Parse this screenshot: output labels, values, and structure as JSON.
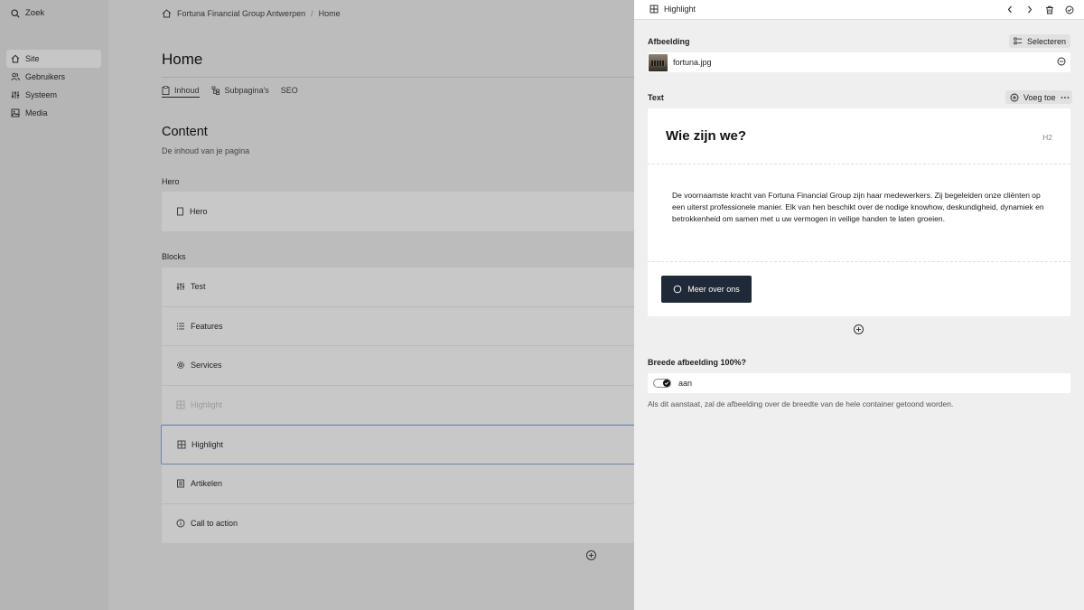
{
  "sidebar": {
    "search_label": "Zoek",
    "items": [
      {
        "label": "Site",
        "icon": "home-icon",
        "active": true
      },
      {
        "label": "Gebruikers",
        "icon": "users-icon"
      },
      {
        "label": "Systeem",
        "icon": "sliders-icon"
      },
      {
        "label": "Media",
        "icon": "image-icon"
      }
    ]
  },
  "main": {
    "breadcrumb": [
      "Fortuna Financial Group Antwerpen",
      "Home"
    ],
    "breadcrumb_separator": "/",
    "page_title": "Home",
    "tabs": [
      {
        "label": "Inhoud",
        "icon": "clipboard-icon",
        "active": true
      },
      {
        "label": "Subpagina's",
        "icon": "sitemap-icon"
      },
      {
        "label": "SEO"
      }
    ],
    "content_title": "Content",
    "content_subtitle": "De inhoud van je pagina",
    "hero_label": "Hero",
    "hero_item": "Hero",
    "blocks_label": "Blocks",
    "blocks": [
      {
        "label": "Test",
        "icon": "sliders-icon"
      },
      {
        "label": "Features",
        "icon": "list-icon"
      },
      {
        "label": "Services",
        "icon": "gear-icon"
      },
      {
        "label": "Highlight",
        "icon": "layout-icon",
        "dimmed": true
      },
      {
        "label": "Highlight",
        "icon": "layout-icon",
        "selected": true
      },
      {
        "label": "Artikelen",
        "icon": "document-icon"
      },
      {
        "label": "Call to action",
        "icon": "info-icon"
      }
    ]
  },
  "panel": {
    "title": "Highlight",
    "image_label": "Afbeelding",
    "select_button": "Selecteren",
    "file_name": "fortuna.jpg",
    "text_label": "Text",
    "add_button": "Voeg toe",
    "heading": "Wie zijn we?",
    "heading_level": "H2",
    "body": "De voornaamste kracht van Fortuna Financial Group zijn haar medewerkers. Zij begeleiden onze cliënten op een uiterst professionele manier. Elk van hen beschikt over de nodige knowhow, deskundigheid, dynamiek en betrokkenheid om samen met u uw vermogen in veilige handen te laten groeien.",
    "cta_label": "Meer over ons",
    "toggle_label": "Breede afbeelding 100%?",
    "toggle_value": "aan",
    "toggle_on": true,
    "help_text": "Als dit aanstaat, zal de afbeelding over de breedte van de hele container getoond worden."
  },
  "colors": {
    "cta_background": "#1f2937",
    "selected_border": "#6b86b3"
  }
}
